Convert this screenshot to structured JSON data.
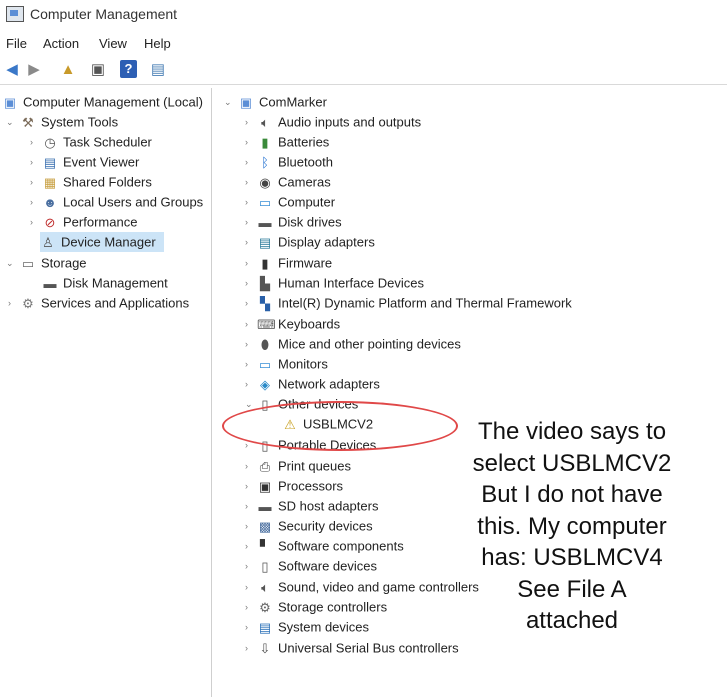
{
  "window": {
    "title": "Computer Management"
  },
  "menu": [
    "File",
    "Action",
    "View",
    "Help"
  ],
  "toolbar": {
    "icons": [
      "back-arrow-icon",
      "forward-arrow-icon",
      "up-folder-icon",
      "show-hide-tree-icon",
      "help-icon",
      "properties-icon"
    ]
  },
  "left_tree": {
    "root": "Computer Management (Local)",
    "system_tools": "System Tools",
    "task_scheduler": "Task Scheduler",
    "event_viewer": "Event Viewer",
    "shared_folders": "Shared Folders",
    "local_users": "Local Users and Groups",
    "performance": "Performance",
    "device_manager": "Device Manager",
    "storage": "Storage",
    "disk_management": "Disk Management",
    "services": "Services and Applications"
  },
  "device_tree": {
    "computer_name": "ComMarker",
    "categories": [
      "Audio inputs and outputs",
      "Batteries",
      "Bluetooth",
      "Cameras",
      "Computer",
      "Disk drives",
      "Display adapters",
      "Firmware",
      "Human Interface Devices",
      "Intel(R) Dynamic Platform and Thermal Framework",
      "Keyboards",
      "Mice and other pointing devices",
      "Monitors",
      "Network adapters",
      "Other devices",
      "USBLMCV2",
      "Portable Devices",
      "Print queues",
      "Processors",
      "SD host adapters",
      "Security devices",
      "Software components",
      "Software devices",
      "Sound, video and game controllers",
      "Storage controllers",
      "System devices",
      "Universal Serial Bus controllers"
    ]
  },
  "annotation": {
    "lines": [
      "The video says to",
      "select USBLMCV2",
      "But I do not have",
      "this. My computer",
      "has: USBLMCV4",
      "See File A",
      "attached"
    ]
  },
  "colors": {
    "selection": "#cce4f7",
    "circle": "#e04848"
  }
}
